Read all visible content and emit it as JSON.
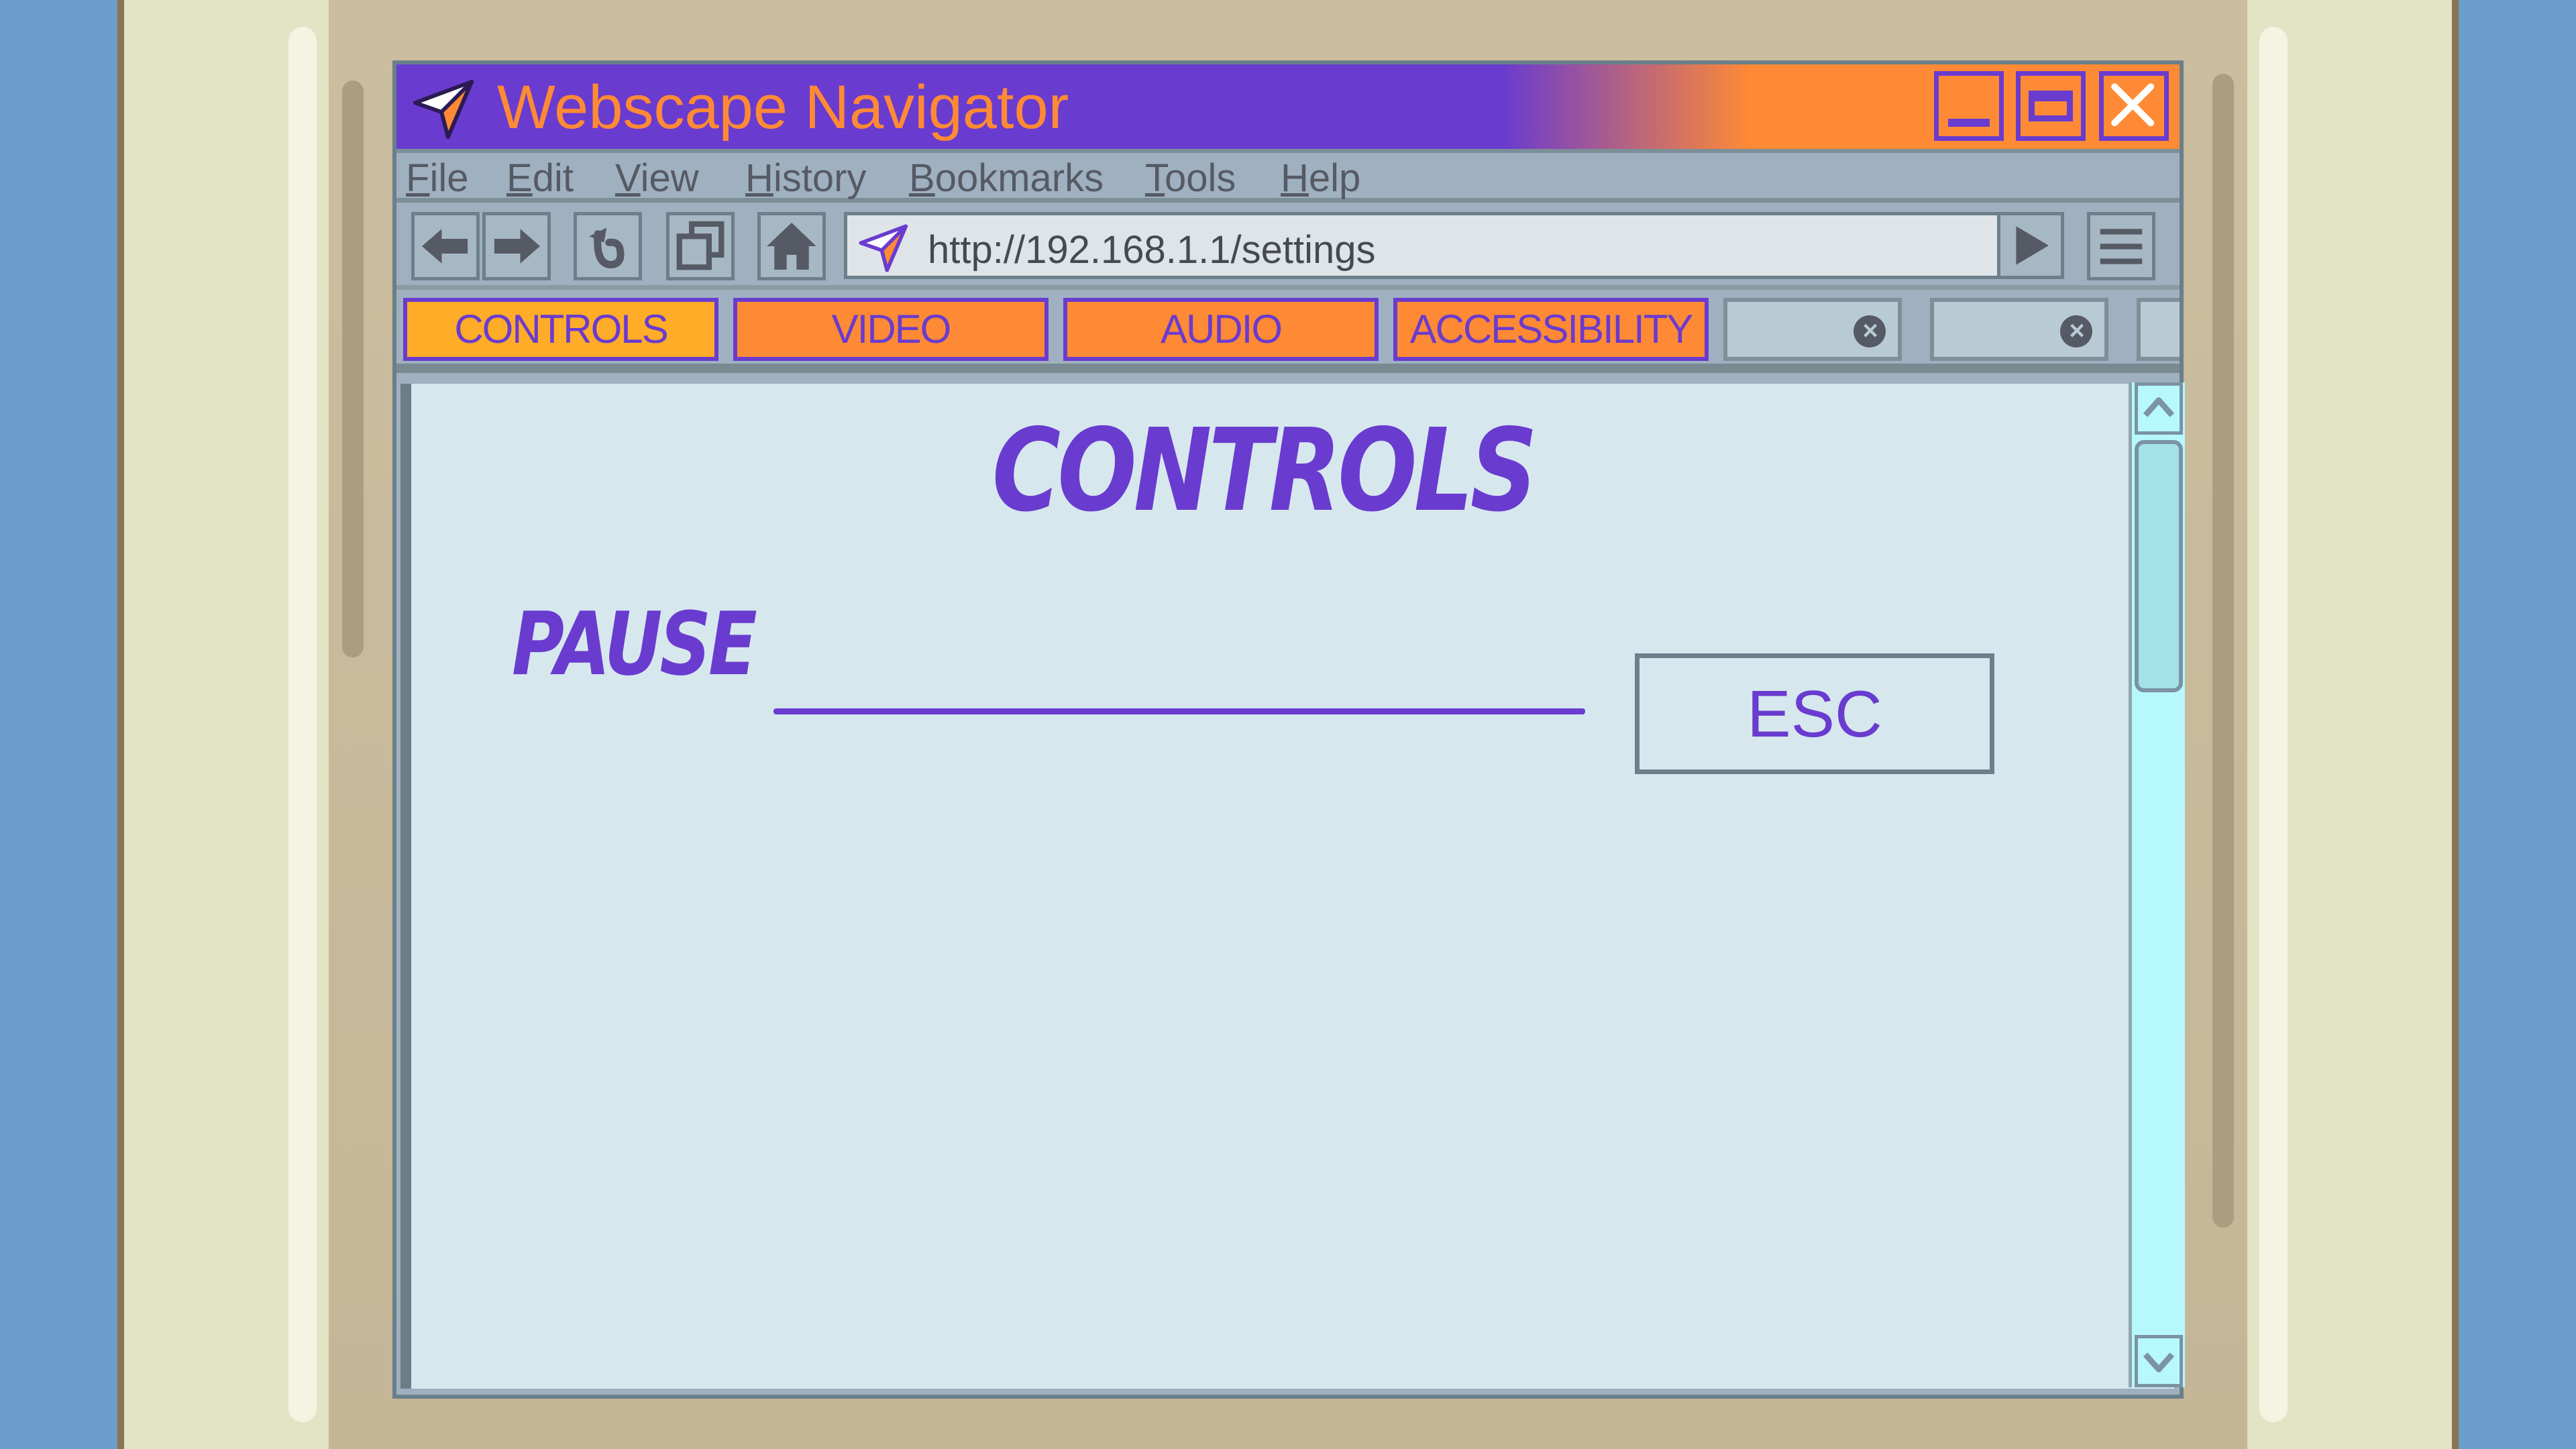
{
  "window": {
    "title": "Webscape Navigator"
  },
  "menu": [
    "File",
    "Edit",
    "View",
    "History",
    "Bookmarks",
    "Tools",
    "Help"
  ],
  "toolbar": {
    "url": "http://192.168.1.1/settings"
  },
  "tabs": [
    "CONTROLS",
    "VIDEO",
    "AUDIO",
    "ACCESSIBILITY"
  ],
  "page": {
    "heading": "CONTROLS",
    "bindings": [
      {
        "action": "PAUSE",
        "key": "ESC"
      }
    ]
  },
  "colors": {
    "accent_purple": "#6a3bcf",
    "accent_orange": "#ff8a35",
    "content_bg": "#d6e8ee",
    "scrollbar": "#b6f8fc"
  },
  "icons": [
    "navigator-logo-icon",
    "minimize-icon",
    "maximize-icon",
    "close-icon",
    "back-arrow-icon",
    "forward-arrow-icon",
    "reload-icon",
    "new-window-icon",
    "home-icon",
    "go-arrow-icon",
    "hamburger-menu-icon",
    "tab-close-icon",
    "scroll-up-icon",
    "scroll-down-icon"
  ]
}
